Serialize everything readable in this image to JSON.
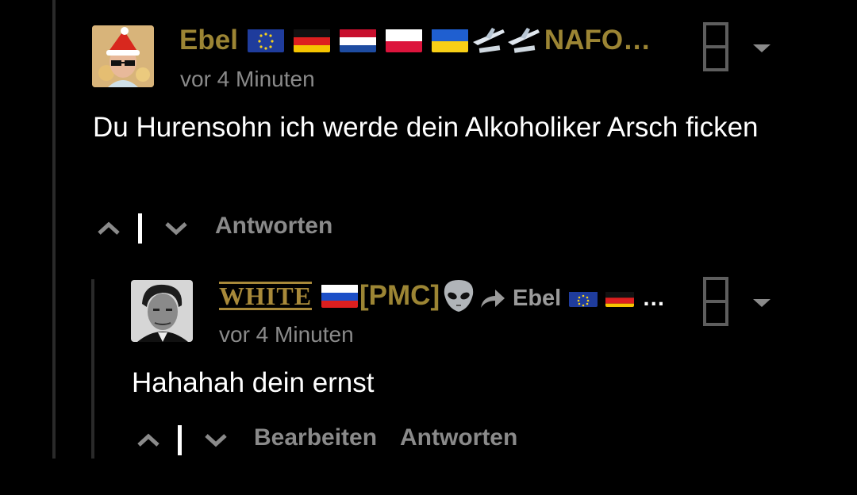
{
  "comment": {
    "author_name": "Ebel",
    "author_suffix": "NAFO…",
    "time": "vor 4 Minuten",
    "text": "Du Hurensohn ich werde dein Alkoholiker Arsch ficken",
    "reply_label": "Antworten"
  },
  "reply": {
    "author_name_styled": "WHITE",
    "author_tag": "[PMC]",
    "replying_to": "Ebel",
    "replying_to_ellipsis": "…",
    "time": "vor 4 Minuten",
    "text": "Hahahah dein ernst",
    "edit_label": "Bearbeiten",
    "reply_label": "Antworten"
  },
  "colors": {
    "username": "#9c8534",
    "muted": "#8a8a8a",
    "background": "#000000"
  },
  "icons": [
    "upvote-icon",
    "downvote-icon",
    "menu-box-icon",
    "dropdown-arrow-icon",
    "reply-arrow-icon",
    "alien-emoji",
    "airplane-emoji",
    "flag-eu",
    "flag-germany",
    "flag-netherlands",
    "flag-poland",
    "flag-ukraine",
    "flag-russia"
  ]
}
